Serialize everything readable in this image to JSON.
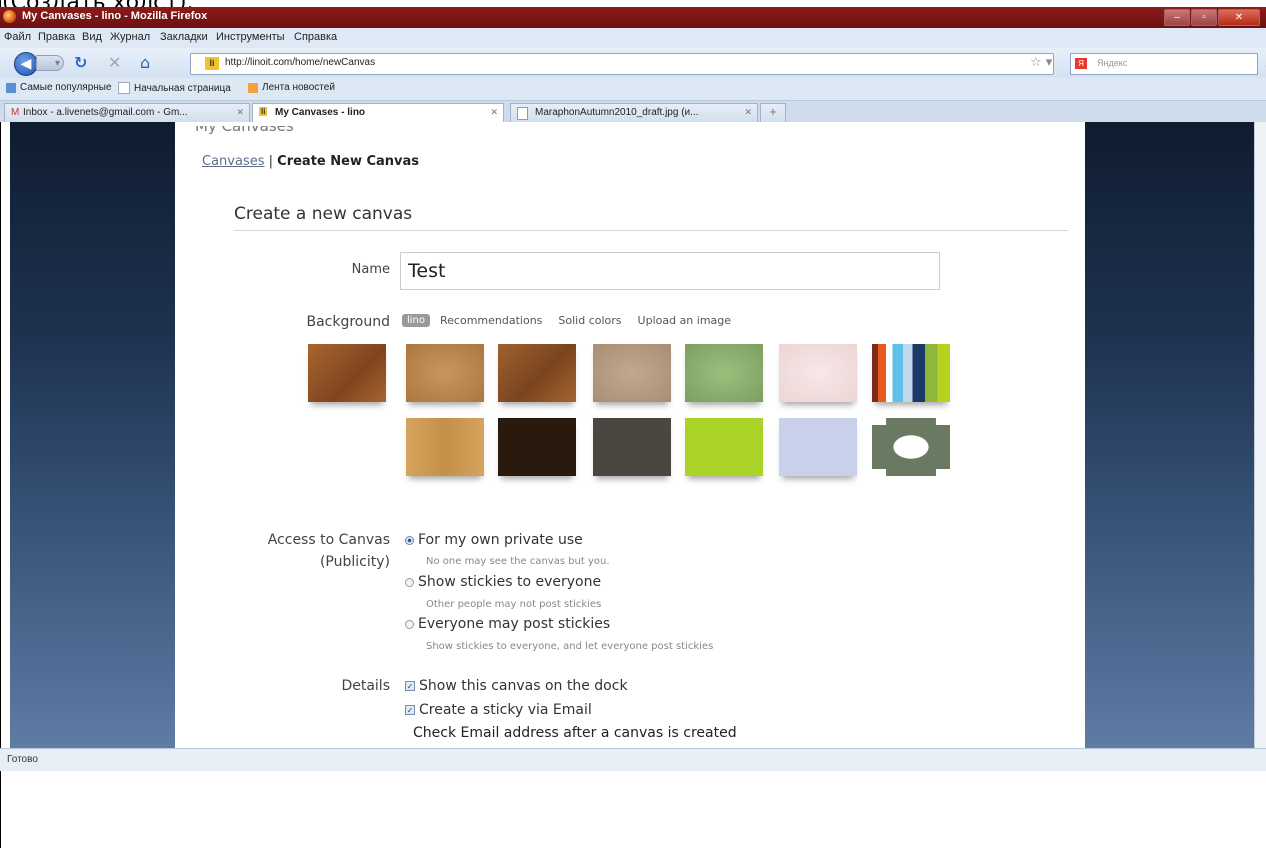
{
  "caption": "(Создать холст).",
  "window": {
    "title": "My Canvases - lino - Mozilla Firefox"
  },
  "menu": [
    "Файл",
    "Правка",
    "Вид",
    "Журнал",
    "Закладки",
    "Инструменты",
    "Справка"
  ],
  "nav": {
    "url": "http://linoit.com/home/newCanvas",
    "favicon_text": "li",
    "search_placeholder": "Яндекс"
  },
  "bookmarks": [
    "Самые популярные",
    "Начальная страница",
    "Лента новостей"
  ],
  "tabs": [
    {
      "label": "Inbox - a.livenets@gmail.com - Gm...",
      "active": false
    },
    {
      "label": "My Canvases - lino",
      "active": true
    },
    {
      "label": "MaraphonAutumn2010_draft.jpg (и...",
      "active": false
    }
  ],
  "page": {
    "cut_heading": "My Canvases",
    "breadcrumb": {
      "link": "Canvases",
      "sep": " | ",
      "current": "Create New Canvas"
    },
    "heading": "Create a new canvas",
    "name_label": "Name",
    "name_value": "Test",
    "background_label": "Background",
    "background_tabs": {
      "active": "lino",
      "options": [
        "Recommendations",
        "Solid colors",
        "Upload an image"
      ]
    },
    "swatch_colors": [
      "#9a5a2a",
      "#b5854e",
      "#94562a",
      "#b59b80",
      "#8aae6e",
      "#f1dede",
      "stripes",
      "#d3a25e",
      "#2a1a0e",
      "#4a4640",
      "#a9d427",
      "#c9d0ea",
      "pattern"
    ],
    "access_label": "Access to Canvas",
    "access_sub": "(Publicity)",
    "access_options": [
      {
        "label": "For my own private use",
        "hint": "No one may see the canvas but you.",
        "selected": true
      },
      {
        "label": "Show stickies to everyone",
        "hint": "Other people may not post stickies",
        "selected": false
      },
      {
        "label": "Everyone may post stickies",
        "hint": "Show stickies to everyone, and let everyone post stickies",
        "selected": false
      }
    ],
    "details_label": "Details",
    "details_options": [
      {
        "label": "Show this canvas on the dock",
        "checked": true
      },
      {
        "label": "Create a sticky via Email",
        "checked": true
      }
    ],
    "email_note": "Check Email address after a canvas is created"
  },
  "status": "Готово"
}
